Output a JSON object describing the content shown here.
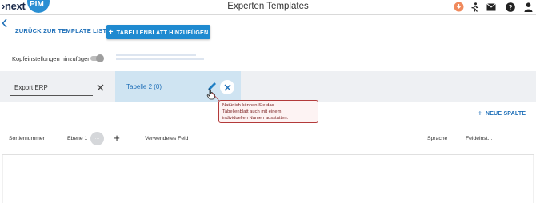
{
  "header": {
    "logo_prefix": "›next",
    "logo_suffix": "PIM",
    "title": "Experten Templates",
    "icons": [
      "notification-icon",
      "run-icon",
      "mail-icon",
      "help-icon",
      "user-icon"
    ],
    "accent_color": "#f08a5d"
  },
  "toolbar": {
    "back_label": "ZURÜCK ZUR TEMPLATE LISTE",
    "add_sheet_label": "TABELLENBLATT HINZUFÜGEN",
    "add_icon": "+",
    "primary_color": "#1f8ad0"
  },
  "settings": {
    "header_settings_label": "Kopfeinstellungen hinzufügen",
    "header_settings_enabled": false
  },
  "sheets": [
    {
      "name": "Export ERP",
      "active": false
    },
    {
      "name": "Tabelle 2 (0)",
      "active": true
    }
  ],
  "tooltip": {
    "lines": [
      "Natürlich können Sie das",
      "Tabellenblatt auch mit einem",
      "individuellen Namen ausstatten."
    ]
  },
  "columns_toolbar": {
    "new_column_label": "NEUE SPALTE",
    "new_column_icon": "+"
  },
  "table": {
    "headers": {
      "sort": "Sortiernummer",
      "level": "Ebene 1",
      "level_toggle": "···",
      "level_add": "+",
      "field": "Verwendetes Feld",
      "language": "Sprache",
      "field_settings": "Feldeinst..."
    }
  }
}
